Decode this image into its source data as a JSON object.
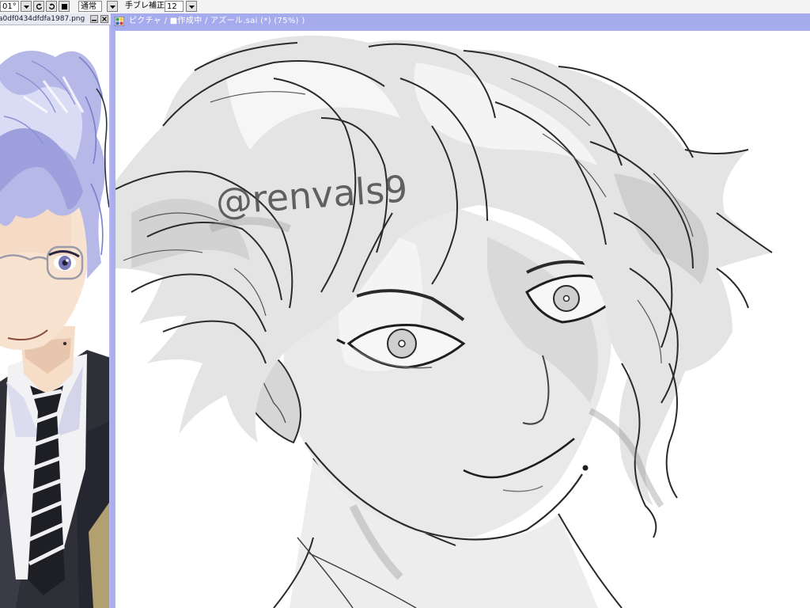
{
  "toolbar": {
    "scale_value": "01°",
    "blend_mode": "通常",
    "stabilizer_label": "手ブレ補正",
    "stabilizer_value": "12"
  },
  "reference_window": {
    "title": "a0df0434dfdfa1987.png"
  },
  "canvas_window": {
    "title": "ピクチャ / ■作成中 / アズール.sai (*) (75%) )"
  },
  "canvas": {
    "signature": "@renvals9"
  },
  "colors": {
    "title_bar": "#a6abee",
    "window_frame": "#b5b8e6",
    "toolbar_bg": "#f4f4f4"
  }
}
